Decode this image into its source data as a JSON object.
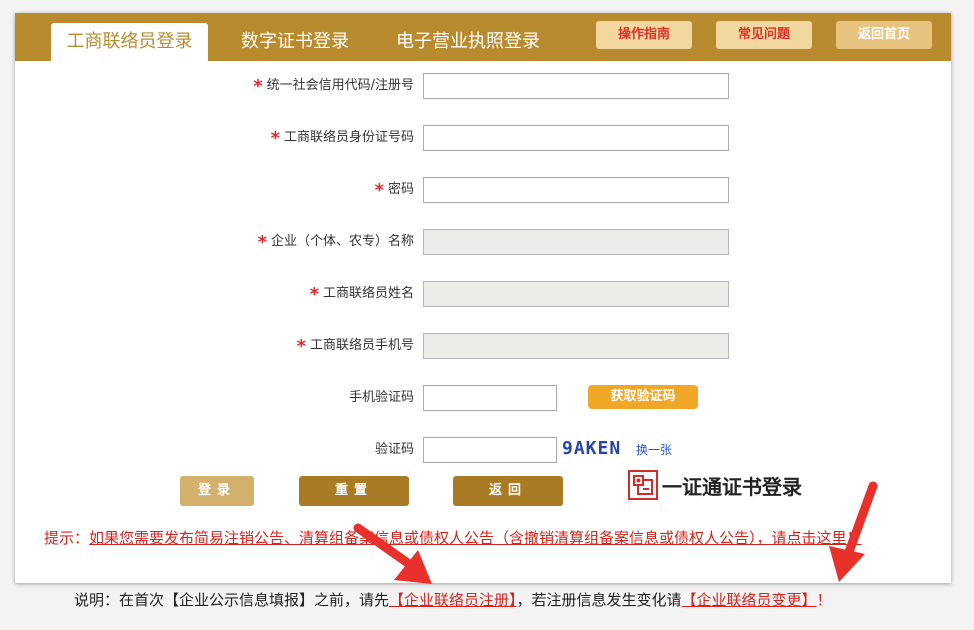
{
  "header": {
    "tabs": [
      {
        "label": "工商联络员登录",
        "active": true
      },
      {
        "label": "数字证书登录",
        "active": false
      },
      {
        "label": "电子营业执照登录",
        "active": false
      }
    ],
    "buttons": {
      "guide": "操作指南",
      "faq": "常见问题",
      "home": "返回首页"
    }
  },
  "form": {
    "required_mark": "*",
    "fields": [
      {
        "label": "统一社会信用代码/注册号",
        "value": "",
        "required": true,
        "disabled": false
      },
      {
        "label": "工商联络员身份证号码",
        "value": "",
        "required": true,
        "disabled": false
      },
      {
        "label": "密码",
        "value": "",
        "required": true,
        "disabled": false
      },
      {
        "label": "企业（个体、农专）名称",
        "value": "",
        "required": true,
        "disabled": true
      },
      {
        "label": "工商联络员姓名",
        "value": "",
        "required": true,
        "disabled": true
      },
      {
        "label": "工商联络员手机号",
        "value": "",
        "required": true,
        "disabled": true
      }
    ],
    "sms": {
      "label": "手机验证码",
      "value": "",
      "button": "获取验证码"
    },
    "captcha": {
      "label": "验证码",
      "value": "",
      "image_text": "9AKEN",
      "refresh": "换一张"
    }
  },
  "actions": {
    "login": "登录",
    "reset": "重置",
    "back": "返回",
    "cert_login": "一证通证书登录"
  },
  "tip": {
    "prefix": "提示：",
    "link": "如果您需要发布简易注销公告、清算组备案信息或债权人公告（含撤销清算组备案信息或债权人公告），请点击这里！"
  },
  "note": {
    "text1": "说明：在首次【企业公示信息填报】之前，请先",
    "link1": "【企业联络员注册】",
    "text2": "，若注册信息发生变化请",
    "link2": "【企业联络员变更】",
    "suffix": "！"
  },
  "colors": {
    "brand": "#b98b2f",
    "accent": "#d0261f",
    "button_orange": "#f0a627"
  }
}
